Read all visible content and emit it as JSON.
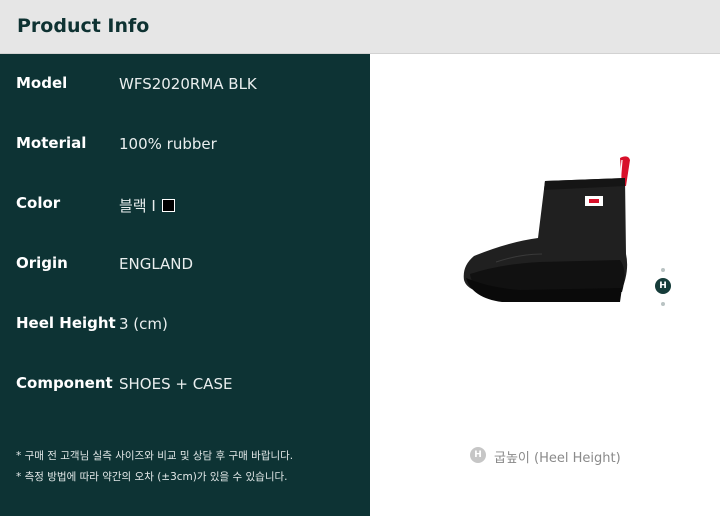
{
  "header": {
    "title": "Product Info"
  },
  "specs": [
    {
      "label": "Model",
      "value": "WFS2020RMA BLK"
    },
    {
      "label": "Moterial",
      "value": "100% rubber"
    },
    {
      "label": "Color",
      "value": "블랙 I"
    },
    {
      "label": "Origin",
      "value": "ENGLAND"
    },
    {
      "label": "Heel Height",
      "value": "3 (cm)"
    },
    {
      "label": "Component",
      "value": "SHOES + CASE"
    }
  ],
  "color_swatch": "#000000",
  "notes": [
    "* 구매 전 고객님 실측 사이즈와 비교 및 상담 후 구매 바랍니다.",
    "* 측정 방법에 따라 약간의 오차 (±3cm)가 있을 수 있습니다."
  ],
  "marker": {
    "letter": "H",
    "icon": "heel-height-marker-icon"
  },
  "legend": {
    "letter": "H",
    "text": "굽높이 (Heel Height)"
  },
  "colors": {
    "panel": "#0d3334",
    "header_bg": "#e6e6e6",
    "accent": "#163c3a"
  }
}
